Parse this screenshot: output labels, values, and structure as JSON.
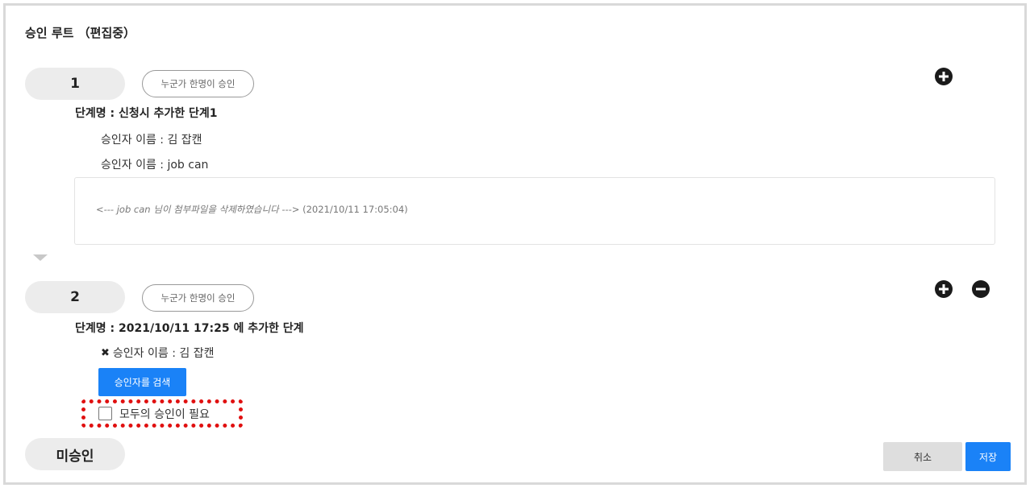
{
  "header": {
    "title": "승인 루트 （편집중）"
  },
  "steps": [
    {
      "number": "1",
      "type_tag": "누군가 한명이 승인",
      "name": "단계명 : 신청시 추가한 단계1",
      "approvers": [
        "승인자 이름 : 김 잡캔",
        "승인자 이름 : job can"
      ],
      "comment": {
        "message": "<--- job can 님이 첨부파일을 삭제하였습니다 --->",
        "timestamp": "(2021/10/11 17:05:04)"
      }
    },
    {
      "number": "2",
      "type_tag": "누군가 한명이 승인",
      "name": "단계명 : 2021/10/11 17:25 에 추가한 단계",
      "approvers": [
        "승인자 이름 : 김 잡캔"
      ],
      "remove_icon": "✖",
      "search_button": "승인자를 검색",
      "require_all_label": "모두의 승인이 필요"
    }
  ],
  "final_status": "미승인",
  "actions": {
    "cancel": "취소",
    "save": "저장"
  },
  "icons": {
    "add": "plus-circle-icon",
    "remove": "minus-circle-icon",
    "expand": "triangle-down-icon"
  },
  "colors": {
    "primary": "#1a82f7",
    "highlight": "#e01010",
    "pill_bg": "#ececec"
  }
}
